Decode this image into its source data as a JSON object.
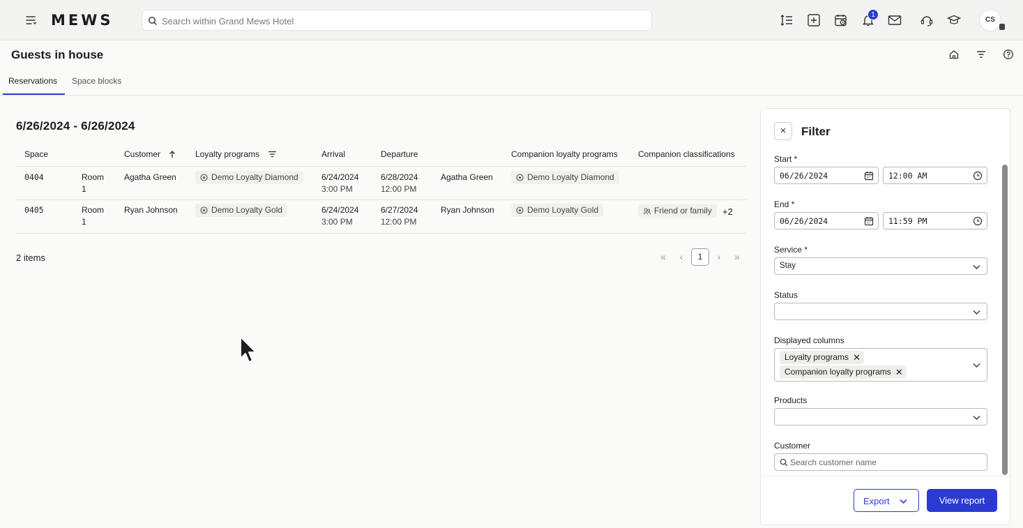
{
  "app": {
    "logo": "MEWS",
    "search_placeholder": "Search within Grand Mews Hotel",
    "notification_count": "1",
    "user_initials": "CS"
  },
  "page": {
    "title": "Guests in house",
    "tabs": [
      {
        "label": "Reservations",
        "active": true
      },
      {
        "label": "Space blocks",
        "active": false
      }
    ]
  },
  "report": {
    "date_range": "6/26/2024 - 6/26/2024",
    "columns": [
      "Space",
      "Customer",
      "Loyalty programs",
      "Arrival",
      "Departure",
      "Companion loyalty programs",
      "Companion classifications"
    ],
    "rows": [
      {
        "space_number": "0404",
        "space_type_line1": "Room",
        "space_type_line2": "1",
        "customer": "Agatha Green",
        "loyalty_program": "Demo Loyalty Diamond",
        "arrival_date": "6/24/2024",
        "arrival_time": "3:00 PM",
        "departure_date": "6/28/2024",
        "departure_time": "12:00 PM",
        "companion": "Agatha Green",
        "companion_loyalty_program": "Demo Loyalty Diamond",
        "companion_classification": "",
        "more_count": ""
      },
      {
        "space_number": "0405",
        "space_type_line1": "Room",
        "space_type_line2": "1",
        "customer": "Ryan Johnson",
        "loyalty_program": "Demo Loyalty Gold",
        "arrival_date": "6/24/2024",
        "arrival_time": "3:00 PM",
        "departure_date": "6/27/2024",
        "departure_time": "12:00 PM",
        "companion": "Ryan Johnson",
        "companion_loyalty_program": "Demo Loyalty Gold",
        "companion_classification": "Friend or family",
        "more_count": "+2"
      }
    ],
    "items_count": "2 items",
    "pagination": {
      "current_page": "1",
      "first": "«",
      "prev": "‹",
      "next": "›",
      "last": "»"
    }
  },
  "filter": {
    "title": "Filter",
    "close": "×",
    "start_label": "Start *",
    "start_date": "06/26/2024",
    "start_time": "12:00 AM",
    "end_label": "End *",
    "end_date": "06/26/2024",
    "end_time": "11:59 PM",
    "service_label": "Service *",
    "service_value": "Stay",
    "status_label": "Status",
    "status_value": "",
    "displayed_columns_label": "Displayed columns",
    "displayed_columns": [
      "Loyalty programs",
      "Companion loyalty programs"
    ],
    "products_label": "Products",
    "products_value": "",
    "customer_label": "Customer",
    "customer_placeholder": "Search customer name",
    "export_label": "Export",
    "view_report_label": "View report"
  },
  "colors": {
    "accent": "#2b3bd1",
    "topbar_bg": "#f3f3f2",
    "page_bg": "#fafaf9"
  }
}
